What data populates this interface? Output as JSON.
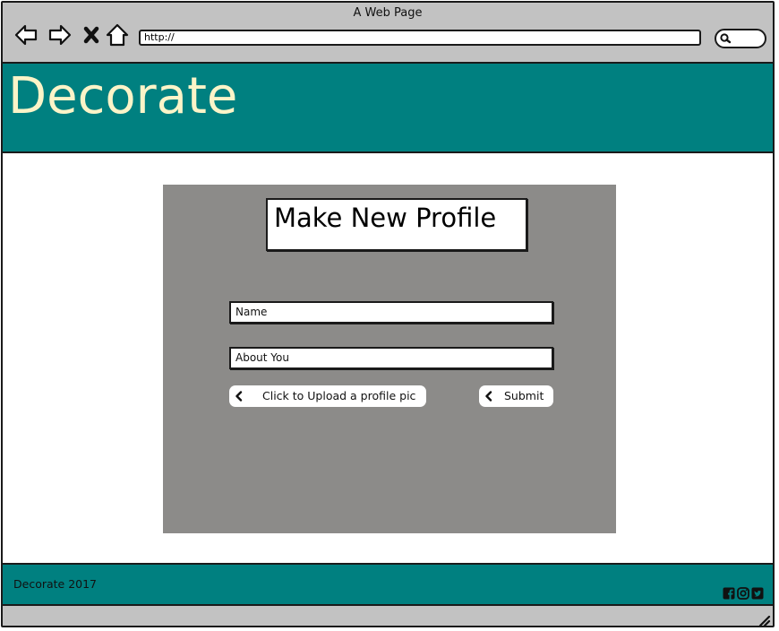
{
  "window": {
    "title": "A Web Page"
  },
  "toolbar": {
    "icons": [
      "back-arrow-icon",
      "forward-arrow-icon",
      "close-x-icon",
      "home-icon"
    ],
    "url": "http://",
    "search_icon": "search-icon"
  },
  "header": {
    "brand": "Decorate",
    "background": "#008080",
    "brand_color": "#fbf4c8"
  },
  "form": {
    "title": "Make New Profile",
    "fields": {
      "name": "Name",
      "about": "About You"
    },
    "buttons": {
      "upload": "Click to Upload a profile pic",
      "submit": "Submit"
    },
    "panel_color": "#8c8b89"
  },
  "footer": {
    "text": "Decorate 2017",
    "social_icons": [
      "facebook-icon",
      "instagram-icon",
      "twitter-icon"
    ]
  }
}
